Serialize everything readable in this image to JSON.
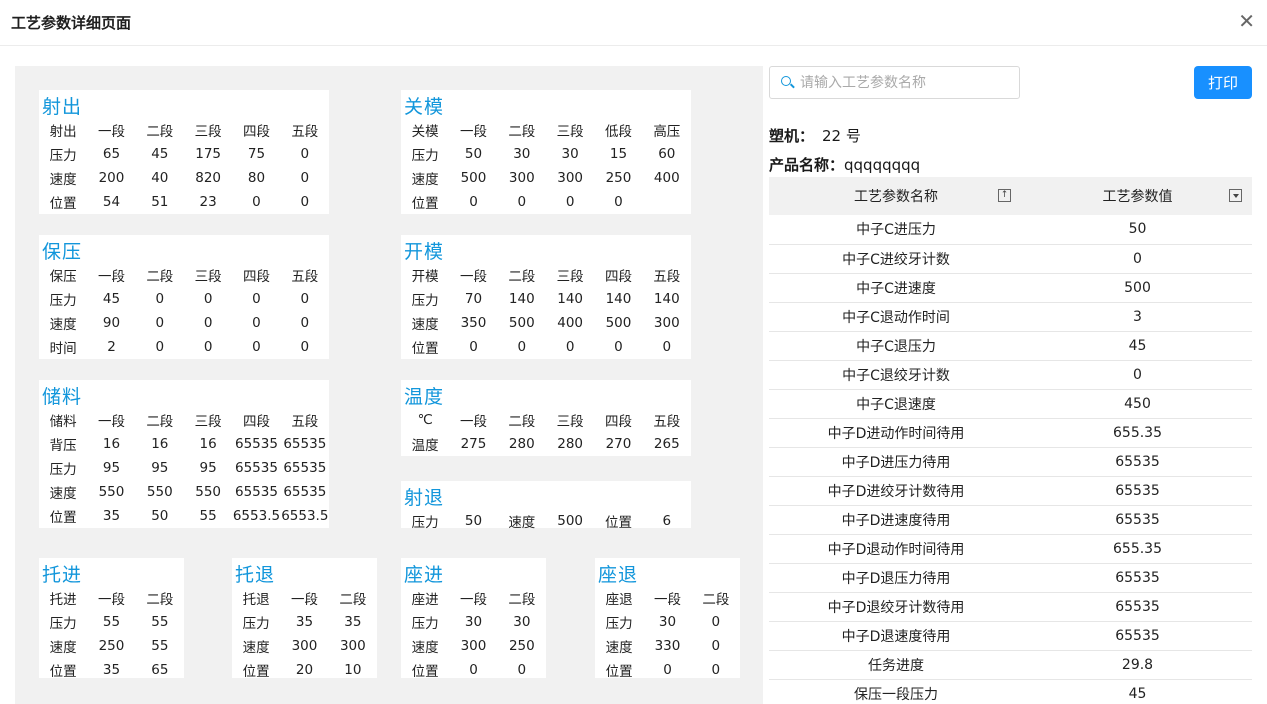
{
  "header": {
    "title": "工艺参数详细页面",
    "close_glyph": "✕"
  },
  "inject": {
    "title": "射出",
    "rows": [
      [
        "射出",
        "一段",
        "二段",
        "三段",
        "四段",
        "五段"
      ],
      [
        "压力",
        "65",
        "45",
        "175",
        "75",
        "0"
      ],
      [
        "速度",
        "200",
        "40",
        "820",
        "80",
        "0"
      ],
      [
        "位置",
        "54",
        "51",
        "23",
        "0",
        "0"
      ]
    ]
  },
  "close_mold": {
    "title": "关模",
    "rows": [
      [
        "关模",
        "一段",
        "二段",
        "三段",
        "低段",
        "高压"
      ],
      [
        "压力",
        "50",
        "30",
        "30",
        "15",
        "60"
      ],
      [
        "速度",
        "500",
        "300",
        "300",
        "250",
        "400"
      ],
      [
        "位置",
        "0",
        "0",
        "0",
        "0",
        ""
      ]
    ]
  },
  "hold": {
    "title": "保压",
    "rows": [
      [
        "保压",
        "一段",
        "二段",
        "三段",
        "四段",
        "五段"
      ],
      [
        "压力",
        "45",
        "0",
        "0",
        "0",
        "0"
      ],
      [
        "速度",
        "90",
        "0",
        "0",
        "0",
        "0"
      ],
      [
        "时间",
        "2",
        "0",
        "0",
        "0",
        "0"
      ]
    ]
  },
  "open_mold": {
    "title": "开模",
    "rows": [
      [
        "开模",
        "一段",
        "二段",
        "三段",
        "四段",
        "五段"
      ],
      [
        "压力",
        "70",
        "140",
        "140",
        "140",
        "140"
      ],
      [
        "速度",
        "350",
        "500",
        "400",
        "500",
        "300"
      ],
      [
        "位置",
        "0",
        "0",
        "0",
        "0",
        "0"
      ]
    ]
  },
  "charge": {
    "title": "储料",
    "rows": [
      [
        "储料",
        "一段",
        "二段",
        "三段",
        "四段",
        "五段"
      ],
      [
        "背压",
        "16",
        "16",
        "16",
        "65535",
        "65535"
      ],
      [
        "压力",
        "95",
        "95",
        "95",
        "65535",
        "65535"
      ],
      [
        "速度",
        "550",
        "550",
        "550",
        "65535",
        "65535"
      ],
      [
        "位置",
        "35",
        "50",
        "55",
        "6553.5",
        "6553.5"
      ]
    ]
  },
  "temperature": {
    "title": "温度",
    "rows": [
      [
        "℃",
        "一段",
        "二段",
        "三段",
        "四段",
        "五段"
      ],
      [
        "温度",
        "275",
        "280",
        "280",
        "270",
        "265"
      ]
    ]
  },
  "suck_back": {
    "title": "射退",
    "rows": [
      [
        "压力",
        "50",
        "速度",
        "500",
        "位置",
        "6"
      ]
    ]
  },
  "ejector_fwd": {
    "title": "托进",
    "rows": [
      [
        "托进",
        "一段",
        "二段"
      ],
      [
        "压力",
        "55",
        "55"
      ],
      [
        "速度",
        "250",
        "55"
      ],
      [
        "位置",
        "35",
        "65"
      ]
    ]
  },
  "ejector_back": {
    "title": "托退",
    "rows": [
      [
        "托退",
        "一段",
        "二段"
      ],
      [
        "压力",
        "35",
        "35"
      ],
      [
        "速度",
        "300",
        "300"
      ],
      [
        "位置",
        "20",
        "10"
      ]
    ]
  },
  "carriage_fwd": {
    "title": "座进",
    "rows": [
      [
        "座进",
        "一段",
        "二段"
      ],
      [
        "压力",
        "30",
        "30"
      ],
      [
        "速度",
        "300",
        "250"
      ],
      [
        "位置",
        "0",
        "0"
      ]
    ]
  },
  "carriage_back": {
    "title": "座退",
    "rows": [
      [
        "座退",
        "一段",
        "二段"
      ],
      [
        "压力",
        "30",
        "0"
      ],
      [
        "速度",
        "330",
        "0"
      ],
      [
        "位置",
        "0",
        "0"
      ]
    ]
  },
  "search": {
    "placeholder": "请输入工艺参数名称",
    "value": ""
  },
  "print_label": "打印",
  "machine": {
    "label": "塑机：",
    "value": "22 号"
  },
  "product": {
    "label": "产品名称：",
    "value": "qqqqqqqq"
  },
  "param_table": {
    "col_name": "工艺参数名称",
    "col_value": "工艺参数值",
    "sort_icon": "sort-ascending-icon",
    "filter_icon": "filter-dropdown-icon",
    "rows": [
      [
        "中子C进压力",
        "50"
      ],
      [
        "中子C进绞牙计数",
        "0"
      ],
      [
        "中子C进速度",
        "500"
      ],
      [
        "中子C退动作时间",
        "3"
      ],
      [
        "中子C退压力",
        "45"
      ],
      [
        "中子C退绞牙计数",
        "0"
      ],
      [
        "中子C退速度",
        "450"
      ],
      [
        "中子D进动作时间待用",
        "655.35"
      ],
      [
        "中子D进压力待用",
        "65535"
      ],
      [
        "中子D进绞牙计数待用",
        "65535"
      ],
      [
        "中子D进速度待用",
        "65535"
      ],
      [
        "中子D退动作时间待用",
        "655.35"
      ],
      [
        "中子D退压力待用",
        "65535"
      ],
      [
        "中子D退绞牙计数待用",
        "65535"
      ],
      [
        "中子D退速度待用",
        "65535"
      ],
      [
        "任务进度",
        "29.8"
      ],
      [
        "保压一段压力",
        "45"
      ]
    ]
  },
  "colors": {
    "accent": "#1296db",
    "button": "#1890ff",
    "panel_bg": "#f1f1f1"
  }
}
